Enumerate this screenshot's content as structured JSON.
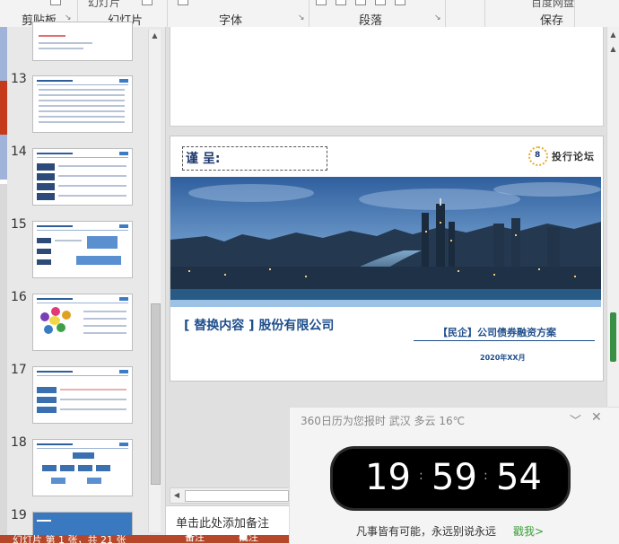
{
  "ribbon": {
    "groups": {
      "clipboard": "剪贴板",
      "slides": "幻灯片",
      "slides_top": "幻灯片",
      "font": "字体",
      "paragraph": "段落",
      "baidu_top": "百度网盘",
      "save": "保存"
    }
  },
  "thumbnails": [
    {
      "num": "13"
    },
    {
      "num": "14"
    },
    {
      "num": "15"
    },
    {
      "num": "16"
    },
    {
      "num": "17"
    },
    {
      "num": "18"
    },
    {
      "num": "19"
    }
  ],
  "slide": {
    "salute": "谨 呈:",
    "brand_mark": "8",
    "brand_name": "投行论坛",
    "company": "[ 替换内容 ] 股份有限公司",
    "subtitle": "【民企】公司债券融资方案",
    "date": "2020年XX月"
  },
  "notes": {
    "placeholder": "单击此处添加备注"
  },
  "status": {
    "slide_info": "幻灯片 第 1 张，共 21 张",
    "notes_btn": "备注",
    "comments_btn": "批注"
  },
  "widget": {
    "title": "360日历为您报时 武汉 多云 16℃",
    "hours": "19",
    "minutes": "59",
    "seconds": "54",
    "motto": "凡事皆有可能，永远别说永远",
    "link": "戳我>"
  },
  "colors": {
    "accent_blue": "#1f4e8c",
    "status_red": "#b7472a",
    "link_green": "#3aa03a"
  }
}
